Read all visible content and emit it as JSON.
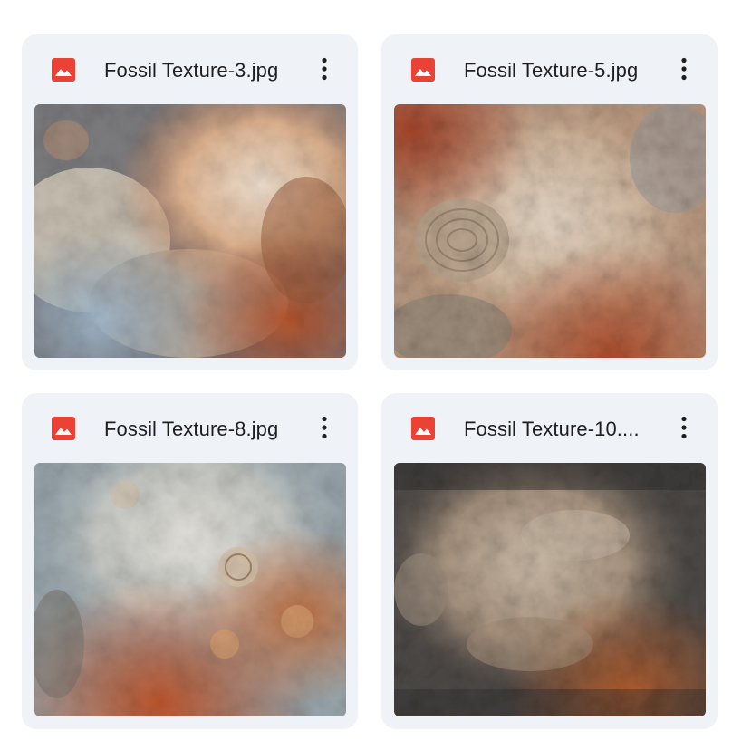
{
  "files": [
    {
      "name": "Fossil Texture-3.jpg",
      "icon": "image-file-icon",
      "menu_icon": "more-vert-icon",
      "thumbnail": "fossil-texture-image"
    },
    {
      "name": "Fossil Texture-5.jpg",
      "icon": "image-file-icon",
      "menu_icon": "more-vert-icon",
      "thumbnail": "fossil-texture-image"
    },
    {
      "name": "Fossil Texture-8.jpg",
      "icon": "image-file-icon",
      "menu_icon": "more-vert-icon",
      "thumbnail": "fossil-texture-image"
    },
    {
      "name": "Fossil Texture-10....",
      "icon": "image-file-icon",
      "menu_icon": "more-vert-icon",
      "thumbnail": "fossil-texture-image"
    }
  ],
  "colors": {
    "card_background": "#eff2f7",
    "image_icon_red": "#ea4335",
    "text": "#1f1f1f",
    "menu_icon": "#1f1f1f"
  }
}
